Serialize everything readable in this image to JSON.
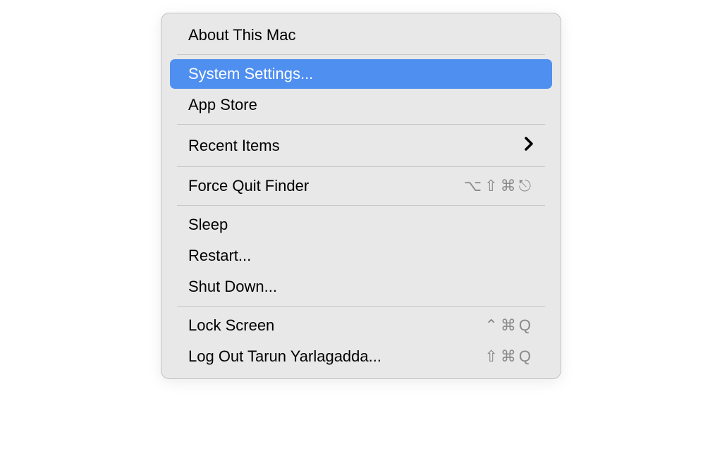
{
  "menu": {
    "items": [
      {
        "label": "About This Mac",
        "type": "item"
      },
      {
        "type": "separator"
      },
      {
        "label": "System Settings...",
        "type": "item",
        "highlighted": true
      },
      {
        "label": "App Store",
        "type": "item"
      },
      {
        "type": "separator"
      },
      {
        "label": "Recent Items",
        "type": "submenu"
      },
      {
        "type": "separator"
      },
      {
        "label": "Force Quit Finder",
        "type": "item",
        "shortcut": "⌥⇧⌘⎋"
      },
      {
        "type": "separator"
      },
      {
        "label": "Sleep",
        "type": "item"
      },
      {
        "label": "Restart...",
        "type": "item"
      },
      {
        "label": "Shut Down...",
        "type": "item"
      },
      {
        "type": "separator"
      },
      {
        "label": "Lock Screen",
        "type": "item",
        "shortcut": "⌃⌘Q"
      },
      {
        "label": "Log Out Tarun Yarlagadda...",
        "type": "item",
        "shortcut": "⇧⌘Q"
      }
    ]
  }
}
